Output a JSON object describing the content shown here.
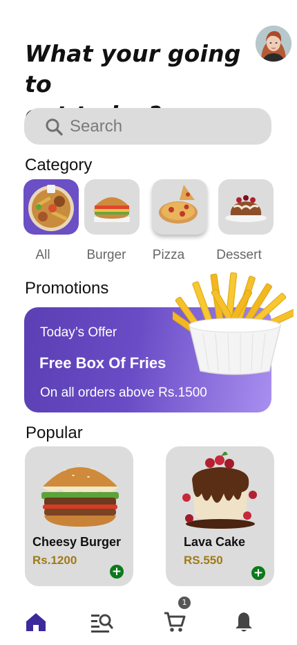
{
  "header": {
    "title_line1": "What your going to",
    "title_line2": "eat today?"
  },
  "search": {
    "placeholder": "Search",
    "icon": "search-icon"
  },
  "category": {
    "title": "Category",
    "items": [
      {
        "label": "All",
        "icon": "mixed-food-platter",
        "selected": true
      },
      {
        "label": "Burger",
        "icon": "burger"
      },
      {
        "label": "Pizza",
        "icon": "pizza"
      },
      {
        "label": "Dessert",
        "icon": "dessert"
      }
    ]
  },
  "promotions": {
    "title": "Promotions",
    "card": {
      "kicker": "Today’s Offer",
      "headline": "Free Box Of Fries",
      "subtitle": "On all orders above Rs.1500"
    }
  },
  "popular": {
    "title": "Popular",
    "items": [
      {
        "name": "Cheesy Burger",
        "price": "Rs.1200"
      },
      {
        "name": "Lava Cake",
        "price": "RS.550"
      }
    ],
    "add_label": "+"
  },
  "nav": {
    "items": [
      "home-icon",
      "search-list-icon",
      "cart-icon",
      "bell-icon"
    ],
    "cart_badge": "1"
  },
  "colors": {
    "primary": "#6b4fc4",
    "nav_active": "#3b2a9c",
    "tile_bg": "#dcdcdc",
    "price": "#a07a17",
    "add_button": "#0c7a1b"
  }
}
